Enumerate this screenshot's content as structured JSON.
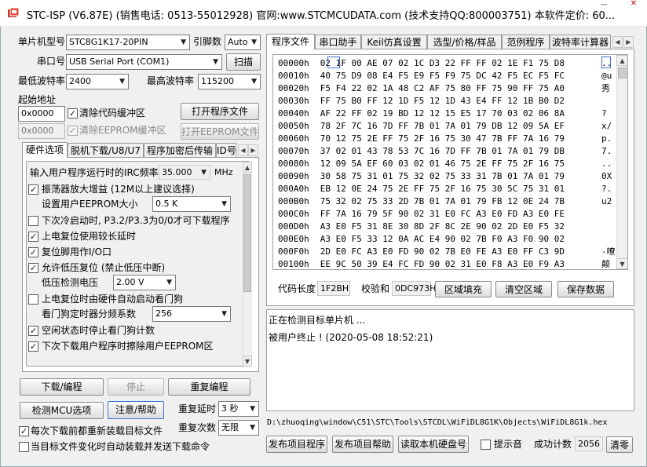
{
  "window": {
    "title": "STC-ISP (V6.87E) (销售电话: 0513-55012928) 官网:www.STCMCUDATA.com  (技术支持QQ:800003751) 本软件定价: 60..."
  },
  "left": {
    "mcu_type_label": "单片机型号",
    "mcu_type_value": "STC8G1K17-20PIN",
    "pin_count_label": "引脚数",
    "pin_count_value": "Auto",
    "serial_port_label": "串口号",
    "serial_port_value": "USB Serial Port (COM1)",
    "scan_button": "扫描",
    "min_baud_label": "最低波特率",
    "min_baud_value": "2400",
    "max_baud_label": "最高波特率",
    "max_baud_value": "115200",
    "start_addr_label": "起始地址",
    "code_start_addr": "0x0000",
    "clear_code_buffer_label": "清除代码缓冲区",
    "open_program_button": "打开程序文件",
    "eeprom_start_addr": "0x0000",
    "clear_eeprom_buffer_label": "清除EEPROM缓冲区",
    "open_eeprom_button": "打开EEPROM文件"
  },
  "option_tabs": [
    {
      "label": "硬件选项"
    },
    {
      "label": "脱机下载/U8/U7"
    },
    {
      "label": "程序加密后传输"
    },
    {
      "label": "ID号"
    }
  ],
  "hardware_options": {
    "irc_freq_label": "输入用户程序运行时的IRC频率",
    "irc_freq_value": "35.000",
    "irc_freq_unit": "MHz",
    "osc_gain_label": "振荡器放大增益 (12M以上建议选择)",
    "eeprom_size_label": "设置用户EEPROM大小",
    "eeprom_size_value": "0.5 K",
    "cold_boot_label": "下次冷启动时, P3.2/P3.3为0/0才可下载程序",
    "long_reset_delay_label": "上电复位使用较长延时",
    "reset_pin_io_label": "复位脚用作I/O口",
    "low_volt_reset_label": "允许低压复位 (禁止低压中断)",
    "low_volt_detect_label": "低压检测电压",
    "low_volt_detect_value": "2.00 V",
    "hw_watchdog_label": "上电复位时由硬件自动启动看门狗",
    "watchdog_prescale_label": "看门狗定时器分频系数",
    "watchdog_prescale_value": "256",
    "idle_stop_watchdog_label": "空闲状态时停止看门狗计数",
    "erase_eeprom_label": "下次下载用户程序时擦除用户EEPROM区"
  },
  "bottom_left": {
    "download_button": "下载/编程",
    "stop_button": "停止",
    "repeat_program_button": "重复编程",
    "detect_mcu_button": "检测MCU选项",
    "help_button": "注意/帮助",
    "repeat_delay_label": "重复延时",
    "repeat_delay_value": "3 秒",
    "repeat_count_label": "重复次数",
    "repeat_count_value": "无限",
    "reload_before_download_label": "每次下载前都重新装载目标文件",
    "auto_load_on_change_label": "当目标文件变化时自动装载并发送下载命令"
  },
  "right_tabs": [
    {
      "label": "程序文件"
    },
    {
      "label": "串口助手"
    },
    {
      "label": "Keil仿真设置"
    },
    {
      "label": "选型/价格/样品"
    },
    {
      "label": "范例程序"
    },
    {
      "label": "波特率计算器"
    }
  ],
  "hex_view": {
    "rows": [
      {
        "addr": "00000h",
        "bytes": "02 1F 00 AE 07 02 1C D3 22 FF FF 02 1E F1 75 D8",
        "ascii": ".."
      },
      {
        "addr": "00010h",
        "bytes": "40 75 D9 08 E4 F5 E9 F5 F9 75 DC 42 F5 EC F5 FC",
        "ascii": "@u"
      },
      {
        "addr": "00020h",
        "bytes": "F5 F4 22 02 1A 48 C2 AF 75 80 FF 75 90 FF 75 A0",
        "ascii": "秀"
      },
      {
        "addr": "00030h",
        "bytes": "FF 75 B0 FF 12 1D F5 12 1D 43 E4 FF 12 1B B0 D2",
        "ascii": ""
      },
      {
        "addr": "00040h",
        "bytes": "AF 22 FF 02 19 BD 12 12 15 E5 17 70 03 02 06 8A",
        "ascii": "?"
      },
      {
        "addr": "00050h",
        "bytes": "78 2F 7C 16 7D FF 7B 01 7A 01 79 DB 12 09 5A EF",
        "ascii": "x/"
      },
      {
        "addr": "00060h",
        "bytes": "70 12 75 2E FF 75 2F 16 75 30 47 7B FF 7A 16 79",
        "ascii": "p."
      },
      {
        "addr": "00070h",
        "bytes": "37 02 01 43 78 53 7C 16 7D FF 7B 01 7A 01 79 DB",
        "ascii": "7."
      },
      {
        "addr": "00080h",
        "bytes": "12 09 5A EF 60 03 02 01 46 75 2E FF 75 2F 16 75",
        "ascii": ".."
      },
      {
        "addr": "00090h",
        "bytes": "30 58 75 31 01 75 32 02 75 33 31 7B 01 7A 01 79",
        "ascii": "0X"
      },
      {
        "addr": "000A0h",
        "bytes": "EB 12 0E 24 75 2E FF 75 2F 16 75 30 5C 75 31 01",
        "ascii": "?."
      },
      {
        "addr": "000B0h",
        "bytes": "75 32 02 75 33 2D 7B 01 7A 01 79 FB 12 0E 24 7B",
        "ascii": "u2"
      },
      {
        "addr": "000C0h",
        "bytes": "FF 7A 16 79 5F 90 02 31 E0 FC A3 E0 FD A3 E0 FE",
        "ascii": ""
      },
      {
        "addr": "000D0h",
        "bytes": "A3 E0 F5 31 8E 30 8D 2F 8C 2E 90 02 2D E0 F5 32",
        "ascii": ""
      },
      {
        "addr": "000E0h",
        "bytes": "A3 E0 F5 33 12 0A AC E4 90 02 7B F0 A3 F0 90 02",
        "ascii": ""
      },
      {
        "addr": "000F0h",
        "bytes": "2D E0 FC A3 E0 FD 90 02 7B E0 FE A3 E0 FF C3 9D",
        "ascii": "-嘹"
      },
      {
        "addr": "00100h",
        "bytes": "EE 9C 50 39 E4 FC FD 90 02 31 E0 F8 A3 E0 F9 A3",
        "ascii": "颠"
      }
    ],
    "code_length_label": "代码长度",
    "code_length_value": "1F2BH",
    "checksum_label": "校验和",
    "checksum_value": "0DC973H",
    "fill_area_button": "区域填充",
    "clear_area_button": "清空区域",
    "save_data_button": "保存数据"
  },
  "log": {
    "lines": [
      "正在检测目标单片机 ...",
      "被用户终止 ! (2020-05-08 18:52:21)"
    ]
  },
  "status_bar": {
    "file_path": "D:\\zhuoqing\\window\\C51\\STC\\Tools\\STCDL\\WiFiDL8G1K\\Objects\\WiFiDL8G1k.hex",
    "publish_project_button": "发布项目程序",
    "publish_help_button": "发布项目帮助",
    "read_disk_id_button": "读取本机硬盘号",
    "beep_label": "提示音",
    "success_count_label": "成功计数",
    "success_count_value": "2056",
    "clear_button": "清零"
  },
  "colors": {
    "accent": "#1a5fb4",
    "highlight_border": "#3a6fd8"
  }
}
